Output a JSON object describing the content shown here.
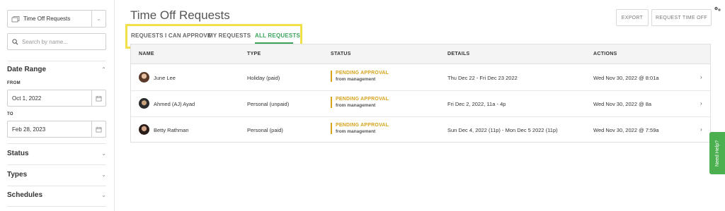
{
  "sidebar": {
    "view_select": "Time Off Requests",
    "search_placeholder": "Search by name...",
    "date_range": {
      "title": "Date Range",
      "from_label": "FROM",
      "from_value": "Oct 1, 2022",
      "to_label": "TO",
      "to_value": "Feb 28, 2023"
    },
    "filters": [
      "Status",
      "Types",
      "Schedules"
    ]
  },
  "header": {
    "title": "Time Off Requests",
    "export_label": "EXPORT",
    "request_label": "REQUEST TIME OFF"
  },
  "tabs": [
    {
      "label": "REQUESTS I CAN APPROVE",
      "active": false
    },
    {
      "label": "MY REQUESTS",
      "active": false
    },
    {
      "label": "ALL REQUESTS",
      "active": true
    }
  ],
  "table": {
    "columns": [
      "NAME",
      "TYPE",
      "STATUS",
      "DETAILS",
      "ACTIONS"
    ],
    "rows": [
      {
        "name": "June Lee",
        "type": "Holiday (paid)",
        "status": "PENDING APPROVAL",
        "status_from": "from management",
        "details": "Thu Dec 22 - Fri Dec 23 2022",
        "actions": "Wed Nov 30, 2022 @ 8:01a"
      },
      {
        "name": "Ahmed (AJ) Ayad",
        "type": "Personal (unpaid)",
        "status": "PENDING APPROVAL",
        "status_from": "from management",
        "details": "Fri Dec 2, 2022, 11a - 4p",
        "actions": "Wed Nov 30, 2022 @ 8a"
      },
      {
        "name": "Betty Rathman",
        "type": "Personal (paid)",
        "status": "PENDING APPROVAL",
        "status_from": "from management",
        "details": "Sun Dec 4, 2022 (11p) - Mon Dec 5 2022 (11p)",
        "actions": "Wed Nov 30, 2022 @ 7:59a"
      }
    ]
  },
  "help_label": "Need Help?",
  "colors": {
    "accent_green": "#3aa35a",
    "pending": "#d9a21b",
    "highlight": "#f2e04a",
    "help": "#4caf50"
  }
}
